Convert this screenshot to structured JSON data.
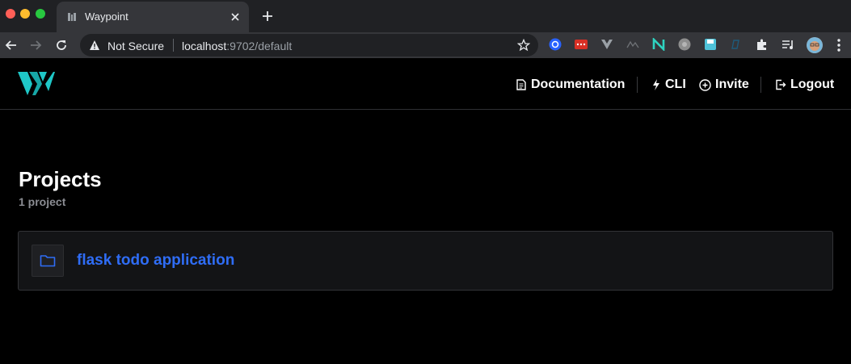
{
  "browser": {
    "tab_title": "Waypoint",
    "security_label": "Not Secure",
    "url_host": "localhost",
    "url_rest": ":9702/default"
  },
  "header": {
    "nav": {
      "documentation": "Documentation",
      "cli": "CLI",
      "invite": "Invite",
      "logout": "Logout"
    }
  },
  "main": {
    "title": "Projects",
    "count": "1 project",
    "projects": [
      {
        "name": "flask todo application"
      }
    ]
  },
  "colors": {
    "accent_link": "#2f6df6",
    "logo_teal": "#1fc7c7",
    "background": "#000000"
  }
}
